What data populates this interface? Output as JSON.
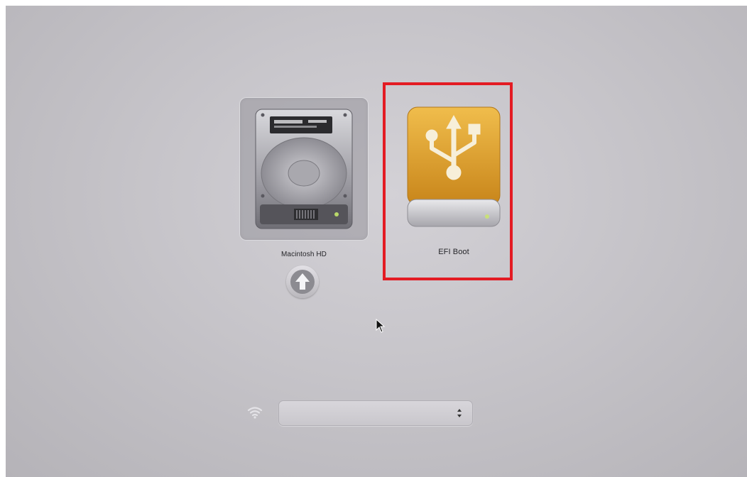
{
  "boot_picker": {
    "volumes": [
      {
        "label": "Macintosh HD",
        "icon": "hard-drive-icon",
        "selected": true
      },
      {
        "label": "EFI Boot",
        "icon": "usb-drive-icon",
        "selected": false
      }
    ],
    "boot_button_icon": "up-arrow-icon"
  },
  "network": {
    "icon": "wifi-icon",
    "selected_value": ""
  },
  "annotation": {
    "color": "#e31b23"
  },
  "colors": {
    "usb_drive": "#e0a32a",
    "background": "#c6c4c9"
  }
}
